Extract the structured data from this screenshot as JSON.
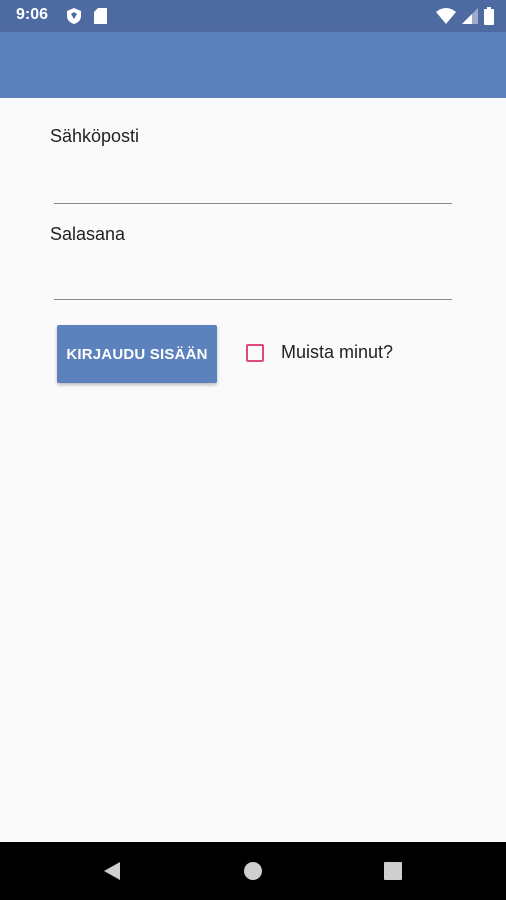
{
  "status_bar": {
    "time": "9:06",
    "icons": [
      "shield-icon",
      "sd-card-icon",
      "wifi-icon",
      "signal-icon",
      "battery-icon"
    ]
  },
  "form": {
    "email_label": "Sähköposti",
    "email_value": "",
    "password_label": "Salasana",
    "password_value": "",
    "login_button_label": "KIRJAUDU SISÄÄN",
    "remember_label": "Muista minut?",
    "remember_checked": false
  },
  "nav_bar": {
    "icons": [
      "back-icon",
      "home-icon",
      "recents-icon"
    ]
  },
  "colors": {
    "status_bar": "#4d6aa1",
    "app_bar": "#5c81bd",
    "accent": "#e04a7a",
    "background": "#fafafa"
  }
}
